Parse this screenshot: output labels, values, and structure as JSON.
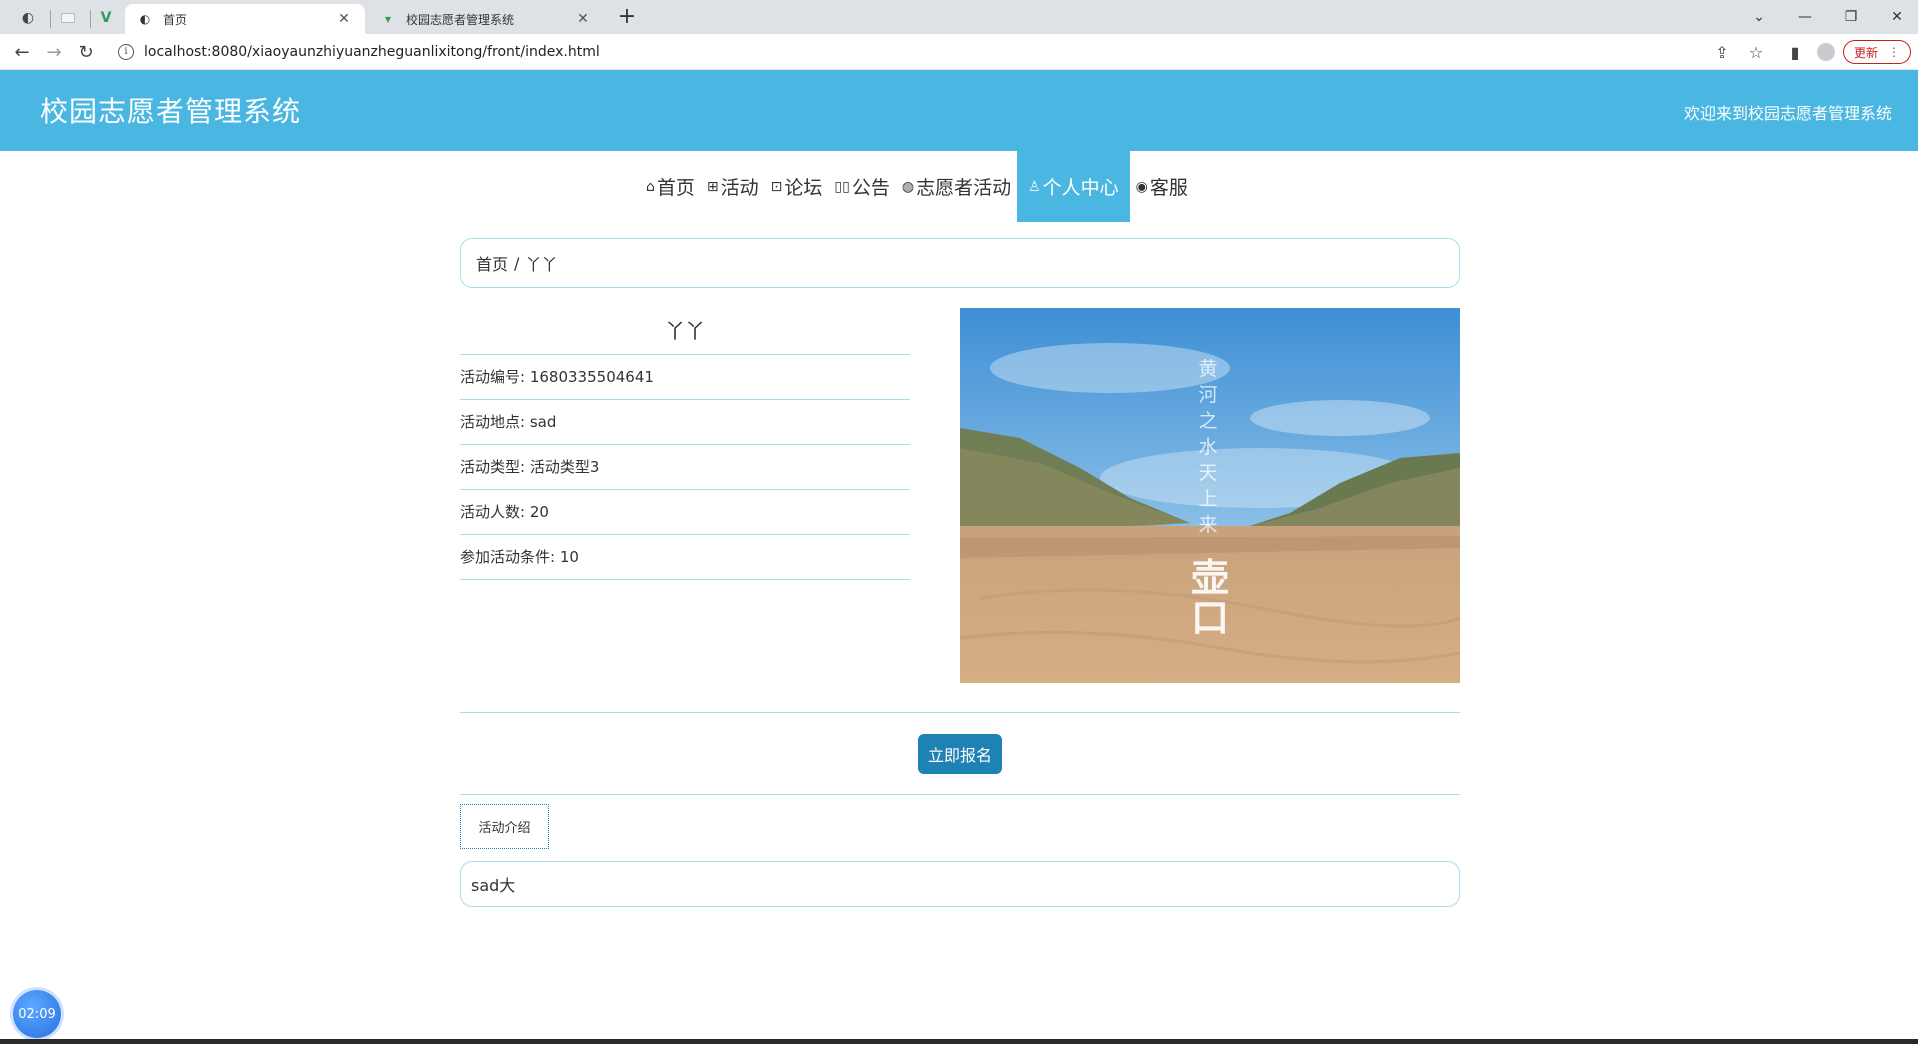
{
  "browser": {
    "tabs": [
      {
        "title": "首页",
        "active": true
      },
      {
        "title": "校园志愿者管理系统",
        "active": false
      }
    ],
    "address": "localhost:8080/xiaoyaunzhiyuanzheguanlixitong/front/index.html",
    "update_label": "更新"
  },
  "header": {
    "title": "校园志愿者管理系统",
    "welcome": "欢迎来到校园志愿者管理系统"
  },
  "nav": {
    "items": [
      {
        "label": "首页",
        "icon": "home-icon"
      },
      {
        "label": "活动",
        "icon": "gift-icon"
      },
      {
        "label": "论坛",
        "icon": "grid-icon"
      },
      {
        "label": "公告",
        "icon": "notice-icon"
      },
      {
        "label": "志愿者活动",
        "icon": "palette-icon"
      },
      {
        "label": "个人中心",
        "icon": "user-icon",
        "active": true
      },
      {
        "label": "客服",
        "icon": "service-icon"
      }
    ]
  },
  "breadcrumb": {
    "home": "首页",
    "separator": "/",
    "current": "丫丫"
  },
  "activity": {
    "name": "丫丫",
    "rows": [
      {
        "label": "活动编号",
        "value": "1680335504641"
      },
      {
        "label": "活动地点",
        "value": "sad"
      },
      {
        "label": "活动类型",
        "value": "活动类型3"
      },
      {
        "label": "活动人数",
        "value": "20"
      },
      {
        "label": "参加活动条件",
        "value": "10"
      }
    ],
    "image_text": {
      "vertical": "黄河之水天上来",
      "calligraphy": "壶口"
    }
  },
  "signup_label": "立即报名",
  "intro": {
    "tab_label": "活动介绍",
    "content": "sad大"
  },
  "timer": "02:09",
  "colors": {
    "header_bg": "#49b7e2",
    "button_bg": "#1e82b4",
    "border": "#a9dde9"
  }
}
